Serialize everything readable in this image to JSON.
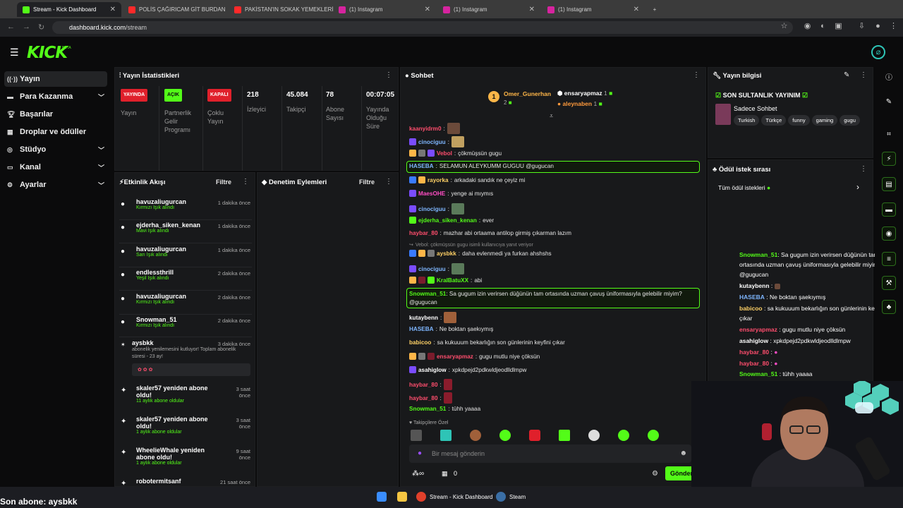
{
  "browser": {
    "tabs": [
      {
        "label": "Stream - Kick Dashboard",
        "active": true,
        "icon": "kick-icon"
      },
      {
        "label": "POLİS ÇAĞIRICAM GİT BURDAN",
        "icon": "youtube-icon"
      },
      {
        "label": "PAKİSTAN'IN SOKAK YEMEKLERİ",
        "icon": "youtube-icon"
      },
      {
        "label": "(1) Instagram",
        "icon": "instagram-icon"
      },
      {
        "label": "(1) Instagram",
        "icon": "instagram-icon"
      },
      {
        "label": "(1) Instagram",
        "icon": "instagram-icon"
      }
    ],
    "url_host": "dashboard.kick.com",
    "url_path": "/stream"
  },
  "sidebar": {
    "items": [
      {
        "label": "Yayın",
        "icon": "stream-icon"
      },
      {
        "label": "Para Kazanma",
        "icon": "money-icon"
      },
      {
        "label": "Başarılar",
        "icon": "trophy-icon"
      },
      {
        "label": "Droplar ve ödüller",
        "icon": "drops-icon"
      },
      {
        "label": "Stüdyo",
        "icon": "studio-icon"
      },
      {
        "label": "Kanal",
        "icon": "channel-icon"
      },
      {
        "label": "Ayarlar",
        "icon": "settings-icon"
      }
    ]
  },
  "stats": {
    "title": "Yayın İstatistikleri",
    "cols": [
      {
        "pill": "YAYINDA",
        "label": "Yayın",
        "color": "#e0202b"
      },
      {
        "pill": "AÇIK",
        "label": "Partnerlik Gelir Programı",
        "color": "#53fc18"
      },
      {
        "pill": "KAPALI",
        "label": "Çoklu Yayın",
        "color": "#e0202b"
      },
      {
        "value": "218",
        "label": "İzleyici"
      },
      {
        "value": "45.084",
        "label": "Takipçi"
      },
      {
        "value": "78",
        "label": "Abone Sayısı"
      },
      {
        "value": "00:07:05",
        "label": "Yayında Olduğu Süre"
      }
    ]
  },
  "activity": {
    "title": "Etkinlik Akışı",
    "filter": "Filtre",
    "events": [
      {
        "user": "havuzaliugurcan",
        "sub": "Kırmızı Işık alındı",
        "time": "1 dakika önce"
      },
      {
        "user": "ejderha_siken_kenan",
        "sub": "Mavi Işık alındı",
        "time": "1 dakika önce"
      },
      {
        "user": "havuzaliugurcan",
        "sub": "Sarı Işık alındı",
        "time": "1 dakika önce"
      },
      {
        "user": "endlessthrill",
        "sub": "Yeşil Işık alındı",
        "time": "2 dakika önce"
      },
      {
        "user": "havuzaliugurcan",
        "sub": "Kırmızı Işık alındı",
        "time": "2 dakika önce"
      },
      {
        "user": "Snowman_51",
        "sub": "Kırmızı Işık alındı",
        "time": "2 dakika önce"
      }
    ],
    "sub_event": {
      "user": "aysbkk",
      "time": "3 dakika önce",
      "text": "abonelik yenilemesini kutluyor! Toplam abonelik süresi - 23 ay!"
    },
    "renewals": [
      {
        "text": "skaler57 yeniden abone oldu!",
        "sub": "11 aylık abone oldular",
        "time": "3 saat önce"
      },
      {
        "text": "skaler57 yeniden abone oldu!",
        "sub": "1 aylık abone oldular",
        "time": "3 saat önce"
      },
      {
        "text": "WheelieWhale yeniden abone oldu!",
        "sub": "1 aylık abone oldular",
        "time": "9 saat önce"
      }
    ],
    "cut_user": "robotermitsanf",
    "cut_time": "21 saat önce"
  },
  "moderation": {
    "title": "Denetim Eylemleri",
    "filter": "Filtre"
  },
  "chat": {
    "title": "Sohbet",
    "top": [
      {
        "name": "Omer_Gunerhan",
        "count": "2",
        "color": "#ffb648"
      },
      {
        "name": "ensaryapmaz",
        "count": "1",
        "color": "#ffffff"
      },
      {
        "name": "aleynaben",
        "count": "1",
        "color": "#ff9a3c"
      }
    ],
    "messages": [
      {
        "nick": "kaanyidrm0",
        "color": "#ff4d6d",
        "text": ""
      },
      {
        "nick": "cinociguu",
        "color": "#7eb6ff",
        "text": ""
      },
      {
        "nick": "Vebol",
        "color": "#ff4d6d",
        "text": "çökmüşsün gugu"
      },
      {
        "nick": "HASEBA",
        "color": "#7eb6ff",
        "text": "SELAMUN ALEYKUMM GUGUU @gugucan"
      },
      {
        "nick": "rayorka",
        "color": "#ffd166",
        "text": "arkadaki sandık ne çeyiz mi"
      },
      {
        "nick": "MaesOHE",
        "color": "#ff4dc4",
        "text": "yenge ai mıymıs"
      },
      {
        "nick": "cinociguu",
        "color": "#7eb6ff",
        "text": ""
      },
      {
        "nick": "ejderha_siken_kenan",
        "color": "#53fc18",
        "text": "ever"
      },
      {
        "nick": "haybar_80",
        "color": "#ff4d6d",
        "text": "mazhar abi ortaama antilop girmiş çıkarman lazım"
      },
      {
        "nick": "aysbkk",
        "color": "#ffd166",
        "text": "daha evlenmedi ya furkan ahshshs"
      },
      {
        "nick": "cinociguu",
        "color": "#7eb6ff",
        "text": ""
      },
      {
        "nick": "KralBatuXX",
        "color": "#53fc18",
        "text": "abi"
      },
      {
        "nick": "Snowman_51",
        "color": "#53fc18",
        "text": "Sa gugum izin verirsen düğünün tam ortasında uzman çavuş üniformasıyla gelebilir miyim? @gugucan"
      },
      {
        "nick": "kutaybenn",
        "color": "#ffffff",
        "text": ""
      },
      {
        "nick": "HASEBA",
        "color": "#7eb6ff",
        "text": "Ne boktan şaekıymış"
      },
      {
        "nick": "babicoo",
        "color": "#ffd166",
        "text": "sa kukuuum bekarlığın son günlerinin keyfini çıkar"
      },
      {
        "nick": "ensaryapmaz",
        "color": "#ff4d6d",
        "text": "gugu mutlu niye çöksün"
      },
      {
        "nick": "asahiglow",
        "color": "#ffffff",
        "text": "xpkdpejd2pdkwldjeodlldlmpw"
      },
      {
        "nick": "haybar_80",
        "color": "#ff4d6d",
        "text": ""
      },
      {
        "nick": "haybar_80",
        "color": "#ff4d6d",
        "text": ""
      },
      {
        "nick": "Snowman_51",
        "color": "#53fc18",
        "text": "tühh yaaaa"
      }
    ],
    "reply_hint": "Vebol: çökmüşsün gugu isimli kullanıcıya yanıt veriyor",
    "emote_label": "Takipçilere Özel",
    "input_placeholder": "Bir mesaj gönderin",
    "count0": "0",
    "send": "Gönder"
  },
  "stream_info": {
    "title": "Yayın bilgisi",
    "stream_title": "SON SULTANLIK YAYINIM",
    "category": "Sadece Sohbet",
    "tags": [
      "Turkish",
      "Türkçe",
      "funny",
      "gaming",
      "gugu"
    ]
  },
  "rewards": {
    "title": "Ödül istek sırası",
    "all": "Tüm ödül istekleri"
  },
  "overlay_chat": [
    {
      "nick": "Snowman_51",
      "color": "#53fc18",
      "text": ": Sa gugum izin verirsen düğünün tam"
    },
    {
      "nick": "",
      "color": "#ffffff",
      "text": "ortasında uzman çavuş üniformasıyla gelebilir miyim?"
    },
    {
      "nick": "",
      "color": "#ffffff",
      "text": "@gugucan"
    },
    {
      "nick": "kutaybenn",
      "color": "#ffffff",
      "text": ":"
    },
    {
      "nick": "HASEBA",
      "color": "#7eb6ff",
      "text": ": Ne boktan şaekıymış"
    },
    {
      "nick": "babicoo",
      "color": "#ffd166",
      "text": ": sa kukuuum bekarlığın son günlerinin keyfini"
    },
    {
      "nick": "",
      "color": "#ffffff",
      "text": "çıkar"
    },
    {
      "nick": "ensaryapmaz",
      "color": "#ff4d6d",
      "text": ": gugu mutlu niye çöksün"
    },
    {
      "nick": "asahiglow",
      "color": "#ffffff",
      "text": ": xpkdpejd2pdkwldjeodlldlmpw"
    },
    {
      "nick": "haybar_80",
      "color": "#ff4d6d",
      "text": ":"
    },
    {
      "nick": "haybar_80",
      "color": "#ff4d6d",
      "text": ":"
    },
    {
      "nick": "Snowman_51",
      "color": "#53fc18",
      "text": ": tühh yaaaa"
    }
  ],
  "last_sub": "Son abone: aysbkk",
  "taskbar": {
    "apps": [
      "Stream - Kick Dashboard",
      "Steam"
    ]
  }
}
